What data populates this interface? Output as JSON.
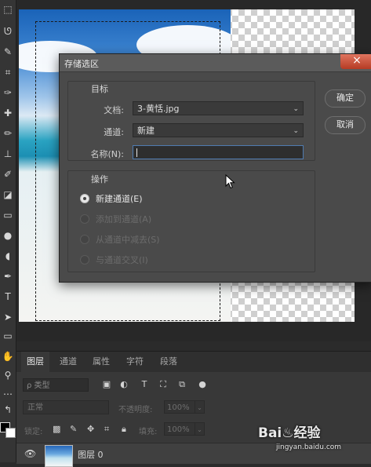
{
  "dialog": {
    "title": "存储选区",
    "close_symbol": "×",
    "target_group_label": "目标",
    "document_label": "文档:",
    "document_value": "3-黄恬.jpg",
    "channel_label": "通道:",
    "channel_value": "新建",
    "name_label": "名称(N):",
    "name_value": "",
    "operation_group_label": "操作",
    "options": [
      {
        "label": "新建通道(E)",
        "selected": true,
        "enabled": true
      },
      {
        "label": "添加到通道(A)",
        "selected": false,
        "enabled": false
      },
      {
        "label": "从通道中减去(S)",
        "selected": false,
        "enabled": false
      },
      {
        "label": "与通道交叉(I)",
        "selected": false,
        "enabled": false
      }
    ],
    "ok_label": "确定",
    "cancel_label": "取消"
  },
  "layers_panel": {
    "tabs": [
      "图层",
      "通道",
      "属性",
      "字符",
      "段落"
    ],
    "active_tab": 0,
    "filter_placeholder": "ρ 类型",
    "blend_mode": "正常",
    "opacity_label": "不透明度:",
    "opacity_value": "100%",
    "lock_label": "锁定:",
    "fill_label": "填充:",
    "fill_value": "100%",
    "layer_name": "图层 0"
  },
  "watermark": {
    "text": "Bai♨经验",
    "url": "jingyan.baidu.com"
  },
  "colors": {
    "dialog_bg": "#4a4a4a",
    "close_button": "#c8492f",
    "ui_dark": "#2b2b2b"
  }
}
